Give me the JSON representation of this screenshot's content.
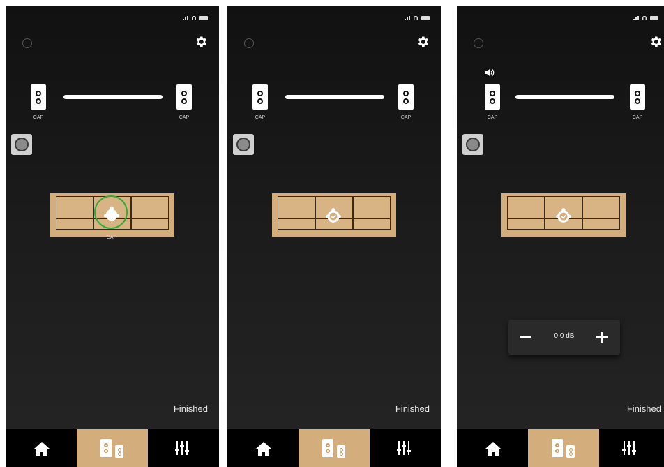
{
  "speaker_label": "CAP",
  "listener_label": "CAP",
  "db_value": "0.0 dB",
  "finished_label": "Finished",
  "colors": {
    "accent_tan": "#d3ae7c",
    "ring_green": "#2fae3a",
    "background_dark": "#111111"
  },
  "icons": [
    "signal-icon",
    "wifi-icon",
    "battery-icon",
    "brand-logo",
    "gear-icon",
    "speaker-icon",
    "volume-icon",
    "microphone-button",
    "sofa",
    "listener-icon",
    "check-icon",
    "home-icon",
    "speaker-setup-icon",
    "equalizer-icon"
  ],
  "tabs": [
    "home",
    "speaker-setup",
    "equalizer"
  ],
  "active_tab": "speaker-setup"
}
